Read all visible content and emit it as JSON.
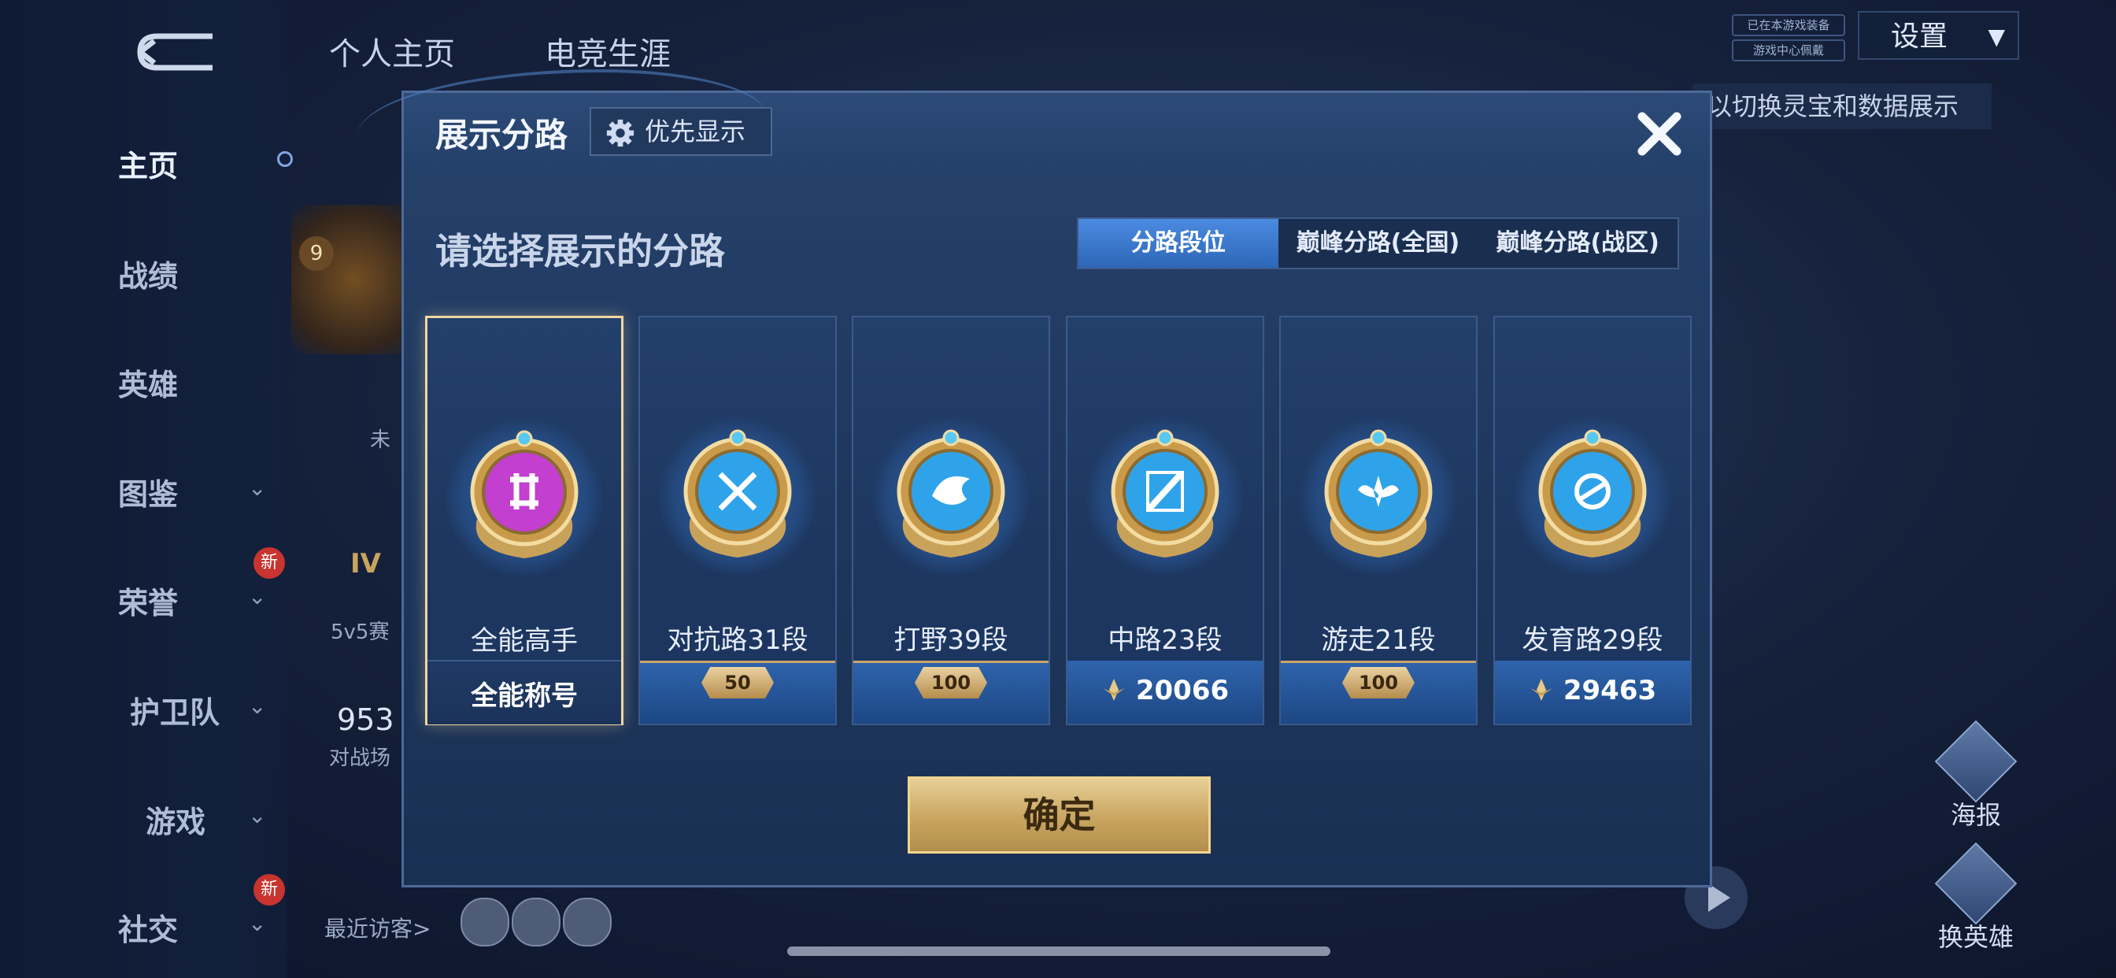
{
  "background": {
    "top_tabs": [
      "个人主页",
      "电竞生涯"
    ],
    "sidebar": [
      {
        "label": "主页",
        "active": true,
        "chevron": false,
        "new": false
      },
      {
        "label": "战绩",
        "active": false,
        "chevron": false,
        "new": false
      },
      {
        "label": "英雄",
        "active": false,
        "chevron": false,
        "new": false
      },
      {
        "label": "图鉴",
        "active": false,
        "chevron": true,
        "new": false
      },
      {
        "label": "荣誉",
        "active": false,
        "chevron": true,
        "new": true
      },
      {
        "label": "护卫队",
        "active": false,
        "chevron": true,
        "new": false
      },
      {
        "label": "游戏",
        "active": false,
        "chevron": true,
        "new": false
      },
      {
        "label": "社交",
        "active": false,
        "chevron": true,
        "new": true
      }
    ],
    "new_badge": "新",
    "level_badge": "9",
    "unranked_text": "未",
    "tier_text": "IV",
    "season_text": "5v5赛",
    "score_partial": "953",
    "battle_partial": "对战场",
    "recent_visitors": "最近访客>",
    "settings_label": "设置",
    "tiny_badges": [
      "已在本游戏装备",
      "游戏中心佩戴"
    ],
    "hint": "以切换灵宝和数据展示",
    "right_buttons": [
      "海报",
      "换英雄"
    ]
  },
  "dialog": {
    "title": "展示分路",
    "priority_label": "优先显示",
    "subtitle": "请选择展示的分路",
    "tabs": [
      {
        "label": "分路段位",
        "active": true
      },
      {
        "label": "巅峰分路(全国)",
        "active": false
      },
      {
        "label": "巅峰分路(战区)",
        "active": false
      }
    ],
    "cards": [
      {
        "name": "全能高手",
        "footer_type": "text",
        "footer": "全能称号",
        "selected": true,
        "emblem": "all-round-emblem-icon",
        "core_color": "#c23fd0"
      },
      {
        "name": "对抗路31段",
        "footer_type": "rank",
        "footer": "50",
        "selected": false,
        "emblem": "crossed-swords-emblem-icon",
        "core_color": "#2fa3ea"
      },
      {
        "name": "打野39段",
        "footer_type": "rank",
        "footer": "100",
        "selected": false,
        "emblem": "dragon-emblem-icon",
        "core_color": "#2fa3ea"
      },
      {
        "name": "中路23段",
        "footer_type": "points",
        "footer": "20066",
        "selected": false,
        "emblem": "mid-lane-emblem-icon",
        "core_color": "#2fa3ea"
      },
      {
        "name": "游走21段",
        "footer_type": "rank",
        "footer": "100",
        "selected": false,
        "emblem": "wings-emblem-icon",
        "core_color": "#2fa3ea"
      },
      {
        "name": "发育路29段",
        "footer_type": "points",
        "footer": "29463",
        "selected": false,
        "emblem": "bow-emblem-icon",
        "core_color": "#2fa3ea"
      }
    ],
    "confirm_label": "确定"
  }
}
